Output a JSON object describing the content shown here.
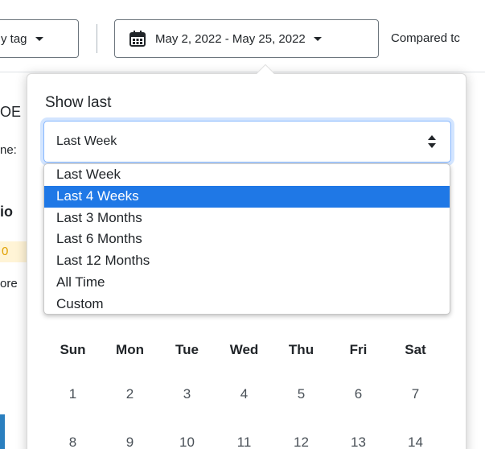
{
  "toolbar": {
    "tag_label": "y tag",
    "date_range": "May 2, 2022 - May 25, 2022",
    "compared_label": "Compared tc"
  },
  "background": {
    "text1": "OE",
    "text2": "ne:",
    "text3": "io",
    "text4": "0",
    "text5": "ore"
  },
  "popover": {
    "show_last_label": "Show last",
    "selected_value": "Last Week",
    "options": [
      "Last Week",
      "Last 4 Weeks",
      "Last 3 Months",
      "Last 6 Months",
      "Last 12 Months",
      "All Time",
      "Custom"
    ],
    "highlighted_option": "Last 4 Weeks"
  },
  "calendar": {
    "weekdays": [
      "Sun",
      "Mon",
      "Tue",
      "Wed",
      "Thu",
      "Fri",
      "Sat"
    ],
    "week1": [
      "1",
      "2",
      "3",
      "4",
      "5",
      "6",
      "7"
    ],
    "week2": [
      "8",
      "9",
      "10",
      "11",
      "12",
      "13",
      "14"
    ]
  }
}
